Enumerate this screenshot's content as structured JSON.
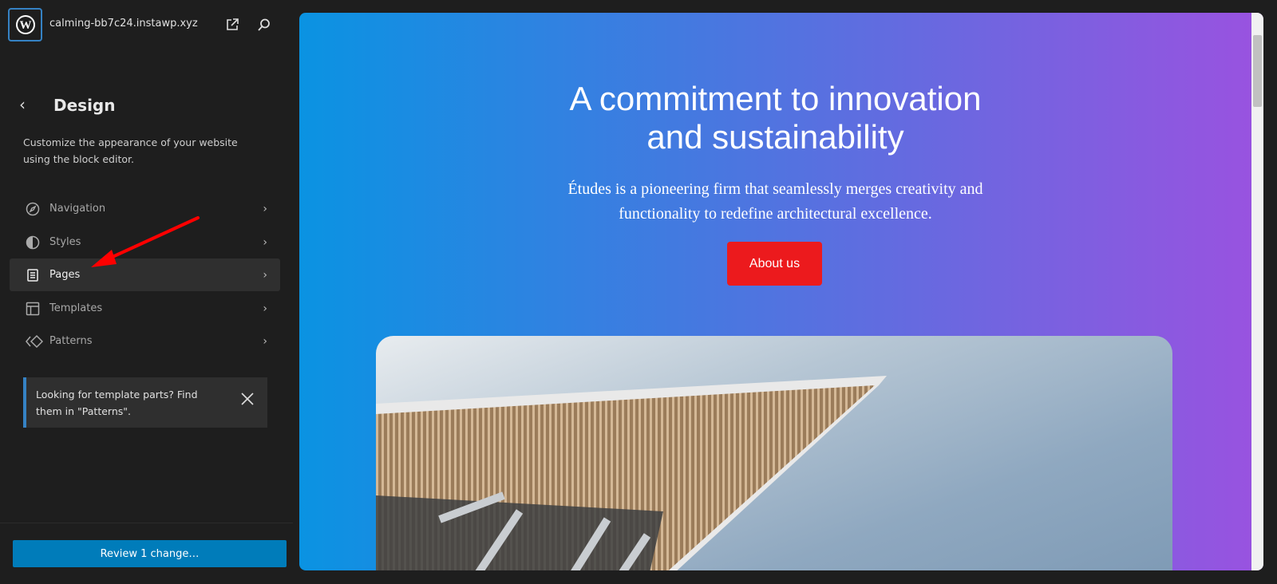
{
  "header": {
    "site_name": "calming-bb7c24.instawp.xyz",
    "icons": [
      "wordpress-logo",
      "external-link-icon",
      "search-icon"
    ]
  },
  "panel": {
    "title": "Design",
    "description": "Customize the appearance of your website using the block editor.",
    "items": [
      {
        "label": "Navigation",
        "icon": "navigation-icon"
      },
      {
        "label": "Styles",
        "icon": "styles-icon"
      },
      {
        "label": "Pages",
        "icon": "pages-icon",
        "active": true
      },
      {
        "label": "Templates",
        "icon": "templates-icon"
      },
      {
        "label": "Patterns",
        "icon": "patterns-icon"
      }
    ],
    "notice": "Looking for template parts? Find them in \"Patterns\"."
  },
  "footer": {
    "review_label": "Review 1 change…"
  },
  "preview": {
    "heading": "A commitment to innovation and sustainability",
    "subheading": "Études is a pioneering firm that seamlessly merges creativity and functionality to redefine architectural excellence.",
    "button": "About us",
    "accent": "#ec1a1d"
  },
  "annotation": {
    "arrow_color": "#ff0000"
  }
}
